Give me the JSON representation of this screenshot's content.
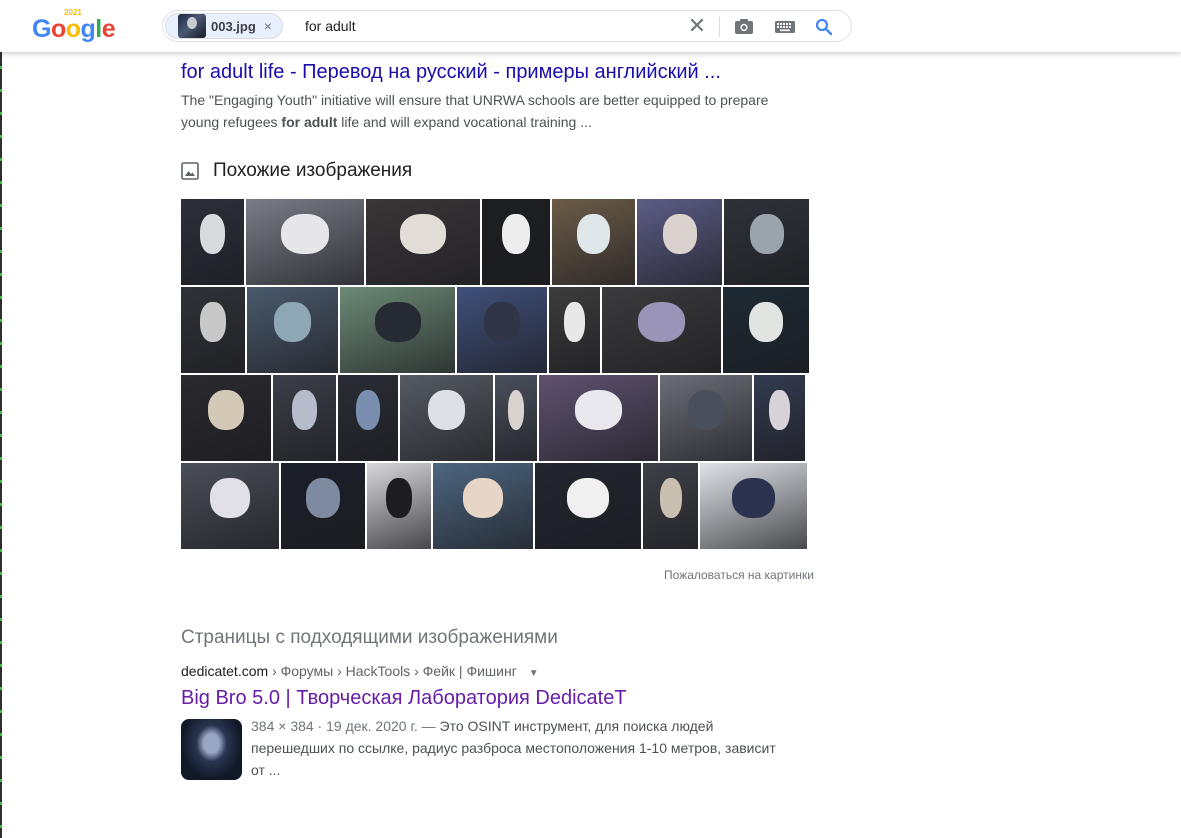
{
  "header": {
    "logo_text": "Google",
    "logo_year": "2021",
    "chip_label": "003.jpg",
    "chip_remove": "×",
    "query": "for adult",
    "clear_glyph": "✕",
    "icons": [
      "camera-icon",
      "keyboard-icon",
      "search-icon"
    ]
  },
  "result1": {
    "title": "for adult life - Перевод на русский - примеры английский ...",
    "snippet_pre": "The \"Engaging Youth\" initiative will ensure that UNRWA schools are better equipped to prepare young refugees ",
    "snippet_bold": "for adult",
    "snippet_post": " life and will expand vocational training ..."
  },
  "similar": {
    "title": "Похожие изображения",
    "report_link": "Пожаловаться на картинки",
    "rows": [
      [
        {
          "w": 63,
          "bg": "#2c2f3a",
          "mask": "#d8dade"
        },
        {
          "w": 118,
          "bg": "#7a7d86",
          "mask": "#e6e6ea"
        },
        {
          "w": 114,
          "bg": "#3a3638",
          "mask": "#e1dcd6"
        },
        {
          "w": 68,
          "bg": "#1d1e20",
          "mask": "#ededed"
        },
        {
          "w": 83,
          "bg": "#6c5c48",
          "mask": "#dfe7ea"
        },
        {
          "w": 85,
          "bg": "#5c5d86",
          "mask": "#d9d2cf"
        },
        {
          "w": 85,
          "bg": "#2e3238",
          "mask": "#9aa4ad"
        }
      ],
      [
        {
          "w": 64,
          "bg": "#303238",
          "mask": "#c8c8c8"
        },
        {
          "w": 91,
          "bg": "#4a5a6c",
          "mask": "#8fa7b5"
        },
        {
          "w": 115,
          "bg": "#6c8a76",
          "mask": "#262a33"
        },
        {
          "w": 90,
          "bg": "#40507a",
          "mask": "#2f3446"
        },
        {
          "w": 51,
          "bg": "#3c3c3c",
          "mask": "#e8e8e8"
        },
        {
          "w": 119,
          "bg": "#3b3a3c",
          "mask": "#9a94b8"
        },
        {
          "w": 86,
          "bg": "#1d2a33",
          "mask": "#e2e4e2"
        }
      ],
      [
        {
          "w": 90,
          "bg": "#2a2a2e",
          "mask": "#d4c9b7"
        },
        {
          "w": 63,
          "bg": "#3c3f48",
          "mask": "#b6bccc"
        },
        {
          "w": 60,
          "bg": "#2a2c35",
          "mask": "#7a8fb0"
        },
        {
          "w": 93,
          "bg": "#555b62",
          "mask": "#dde0e4"
        },
        {
          "w": 42,
          "bg": "#4a4f5c",
          "mask": "#d8d3cf"
        },
        {
          "w": 119,
          "bg": "#5f5270",
          "mask": "#e8e8ee"
        },
        {
          "w": 92,
          "bg": "#6b6e76",
          "mask": "#4a4f5e"
        },
        {
          "w": 51,
          "bg": "#333b50",
          "mask": "#d7d2d7"
        }
      ],
      [
        {
          "w": 98,
          "bg": "#4a4e56",
          "mask": "#e0e0e6"
        },
        {
          "w": 84,
          "bg": "#1b1f28",
          "mask": "#7d8aa0"
        },
        {
          "w": 64,
          "bg": "#d8d8dc",
          "mask": "#1d1d1f"
        },
        {
          "w": 100,
          "bg": "#4d6680",
          "mask": "#e7d6c8"
        },
        {
          "w": 106,
          "bg": "#232630",
          "mask": "#f0f0f0"
        },
        {
          "w": 55,
          "bg": "#3d4047",
          "mask": "#c8bfb0"
        },
        {
          "w": 107,
          "bg": "#dfe3e8",
          "mask": "#2c3350"
        }
      ]
    ]
  },
  "pages": {
    "title": "Страницы с подходящими изображениями",
    "crumb_domain": "dedicatet.com",
    "crumb_path": "› Форумы › HackTools › Фейк | Фишинг",
    "title_link": "Big Bro 5.0 | Творческая Лаборатория DedicateT",
    "meta": "384 × 384 · 19 дек. 2020 г. — ",
    "snippet": "Это OSINT инструмент, для поиска людей перешедших по ссылке, радиус разброса местоположения 1-10 метров, зависит от ..."
  }
}
